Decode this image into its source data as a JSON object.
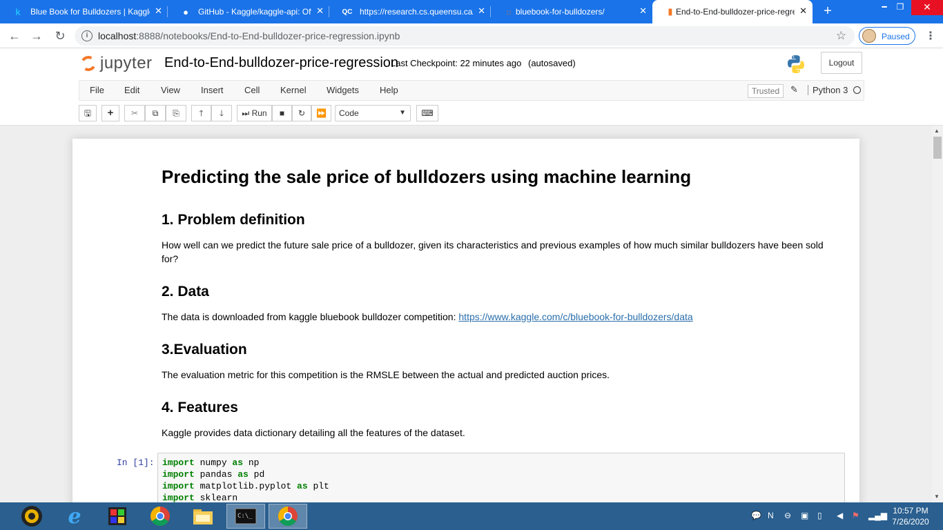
{
  "browser": {
    "tabs": [
      {
        "favicon": "kaggle-icon",
        "favicon_glyph": "k",
        "title": "Blue Book for Bulldozers | Kaggle",
        "active": false
      },
      {
        "favicon": "github-icon",
        "favicon_glyph": "●",
        "title": "GitHub - Kaggle/kaggle-api: Offic",
        "active": false
      },
      {
        "favicon": "queensu-icon",
        "favicon_glyph": "QC",
        "title": "https://research.cs.queensu.ca/h",
        "active": false
      },
      {
        "favicon": "loading-icon",
        "favicon_glyph": "◌",
        "title": "bluebook-for-bulldozers/",
        "active": false
      },
      {
        "favicon": "notebook-icon",
        "favicon_glyph": "▮",
        "title": "End-to-End-bulldozer-price-regre",
        "active": true
      }
    ],
    "new_tab_label": "+",
    "url_host": "localhost",
    "url_rest": ":8888/notebooks/End-to-End-bulldozer-price-regression.ipynb",
    "profile_status": "Paused"
  },
  "jupyter": {
    "logo_text": "jupyter",
    "notebook_name": "End-to-End-bulldozer-price-regression",
    "checkpoint": "Last Checkpoint: 22 minutes ago",
    "autosaved": "(autosaved)",
    "logout_label": "Logout",
    "menu": [
      "File",
      "Edit",
      "View",
      "Insert",
      "Cell",
      "Kernel",
      "Widgets",
      "Help"
    ],
    "trusted_label": "Trusted",
    "kernel_name": "Python 3",
    "run_label": "Run",
    "cell_type": "Code"
  },
  "notebook": {
    "title": "Predicting the sale price of bulldozers using machine learning",
    "sections": [
      {
        "heading": "1. Problem definition",
        "text": "How well can we predict the future sale price of a bulldozer, given its characteristics and previous examples of how much similar bulldozers have been sold for?"
      },
      {
        "heading": "2. Data",
        "text": "The data is downloaded from kaggle bluebook bulldozer competition: ",
        "link": "https://www.kaggle.com/c/bluebook-for-bulldozers/data"
      },
      {
        "heading": "3.Evaluation",
        "text": "The evaluation metric for this competition is the RMSLE between the actual and predicted auction prices."
      },
      {
        "heading": "4. Features",
        "text": "Kaggle provides data dictionary detailing all the features of the dataset."
      }
    ],
    "code_cell": {
      "prompt": "In [1]:",
      "lines": [
        {
          "kw": "import",
          "rest": " numpy ",
          "kw2": "as",
          "rest2": " np"
        },
        {
          "kw": "import",
          "rest": " pandas ",
          "kw2": "as",
          "rest2": " pd"
        },
        {
          "kw": "import",
          "rest": " matplotlib.pyplot ",
          "kw2": "as",
          "rest2": " plt"
        },
        {
          "kw": "import",
          "rest": " sklearn",
          "kw2": "",
          "rest2": ""
        }
      ]
    }
  },
  "taskbar": {
    "time": "10:57 PM",
    "date": "7/26/2020"
  }
}
